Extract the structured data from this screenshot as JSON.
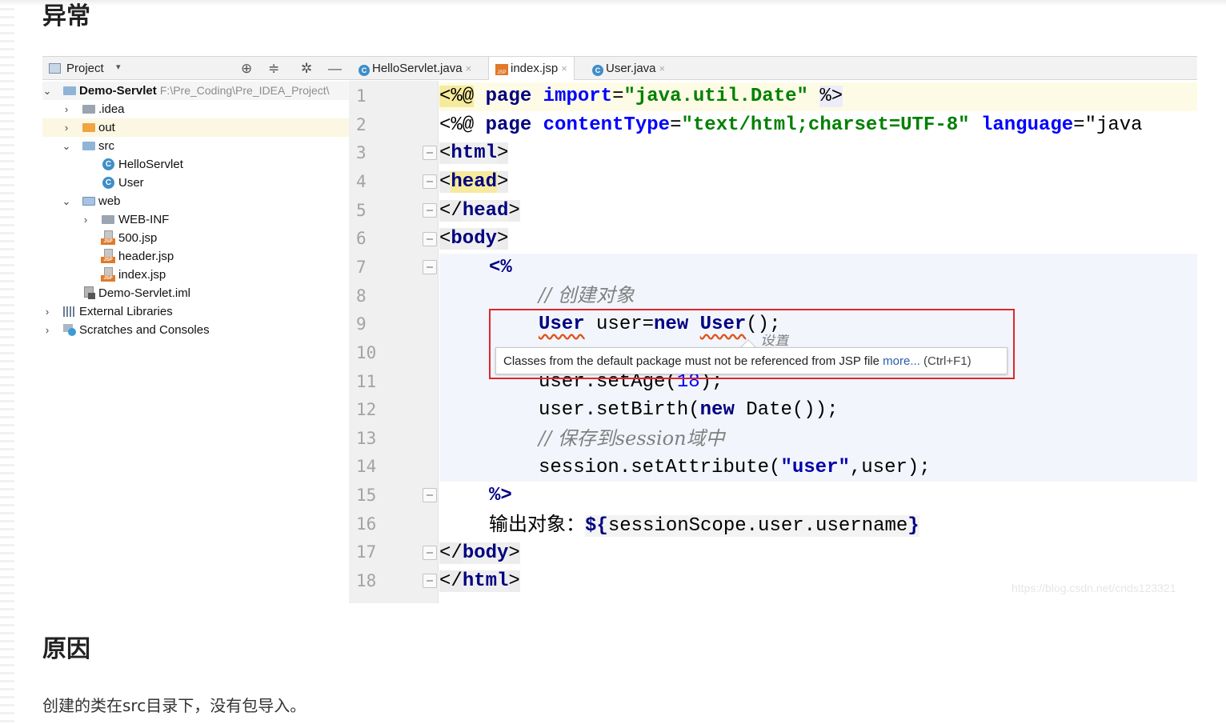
{
  "headings": {
    "exception": "异常",
    "reason": "原因"
  },
  "reason_text": "创建的类在src目录下，没有包导入。",
  "project_panel": {
    "title": "Project",
    "dropdown": "▾",
    "toolbar_icons": [
      "target-icon",
      "collapse-icon",
      "gear-icon",
      "minimize-icon"
    ],
    "toolbar_glyphs": [
      "⊕",
      "≑",
      "✲",
      "—"
    ],
    "tree": [
      {
        "label": "Demo-Servlet",
        "path": "F:\\Pre_Coding\\Pre_IDEA_Project\\",
        "icon": "module-folder-icon",
        "arrow": "⌄"
      },
      {
        "label": ".idea",
        "icon": "folder-icon",
        "arrow": "›"
      },
      {
        "label": "out",
        "icon": "orange-folder-icon",
        "arrow": "›"
      },
      {
        "label": "src",
        "icon": "source-folder-icon",
        "arrow": "⌄"
      },
      {
        "label": "HelloServlet",
        "icon": "class-icon"
      },
      {
        "label": "User",
        "icon": "class-icon"
      },
      {
        "label": "web",
        "icon": "web-folder-icon",
        "arrow": "⌄"
      },
      {
        "label": "WEB-INF",
        "icon": "folder-icon",
        "arrow": "›"
      },
      {
        "label": "500.jsp",
        "icon": "jsp-file-icon"
      },
      {
        "label": "header.jsp",
        "icon": "jsp-file-icon"
      },
      {
        "label": "index.jsp",
        "icon": "jsp-file-icon"
      },
      {
        "label": "Demo-Servlet.iml",
        "icon": "iml-file-icon"
      },
      {
        "label": "External Libraries",
        "icon": "library-icon",
        "arrow": "›"
      },
      {
        "label": "Scratches and Consoles",
        "icon": "scratches-icon",
        "arrow": "›"
      }
    ]
  },
  "tabs": [
    {
      "label": "HelloServlet.java",
      "close": "×",
      "active": false
    },
    {
      "label": "index.jsp",
      "close": "×",
      "active": true
    },
    {
      "label": "User.java",
      "close": "×",
      "active": false
    }
  ],
  "line_numbers": [
    "1",
    "2",
    "3",
    "4",
    "5",
    "6",
    "7",
    "8",
    "9",
    "10",
    "11",
    "12",
    "13",
    "14",
    "15",
    "16",
    "17",
    "18"
  ],
  "code": {
    "l1": {
      "open": "<%@",
      "page": "page",
      "attr": "import",
      "eq": "=",
      "val": "\"java.util.Date\"",
      "close": "%>"
    },
    "l2": {
      "open": "<%@",
      "page": "page",
      "attr1": "contentType",
      "eq": "=",
      "val1": "\"text/html;charset=UTF-8\"",
      "attr2": "language",
      "val2": "=\"java"
    },
    "l3": {
      "lt": "<",
      "tag": "html",
      "gt": ">"
    },
    "l4": {
      "lt": "<",
      "tag": "head",
      "gt": ">"
    },
    "l5": {
      "lt": "</",
      "tag": "head",
      "gt": ">"
    },
    "l6": {
      "lt": "<",
      "tag": "body",
      "gt": ">"
    },
    "l7": {
      "text": "<%"
    },
    "l8": {
      "text": "// 创建对象"
    },
    "l9": {
      "cls": "User",
      "mid": " user=",
      "new": "new",
      "cls2": "User",
      "end": "();"
    },
    "l10": {
      "text": "设置"
    },
    "l11": {
      "pre": "user.setAge(",
      "num": "18",
      "end": ");"
    },
    "l12": {
      "pre": "user.setBirth(",
      "new": "new",
      "end": " Date());"
    },
    "l13": {
      "text": "// 保存到session域中"
    },
    "l14": {
      "pre": "session.setAttribute(",
      "str": "\"user\"",
      "end": ",user);"
    },
    "l15": {
      "text": "%>"
    },
    "l16": {
      "label": "输出对象：",
      "el_open": "${",
      "expr": "sessionScope.user.username",
      "el_close": "}"
    },
    "l17": {
      "lt": "</",
      "tag": "body",
      "gt": ">"
    },
    "l18": {
      "lt": "</",
      "tag": "html",
      "gt": ">"
    }
  },
  "tooltip": {
    "message": "Classes from the default package must not be referenced from JSP file ",
    "link": "more...",
    "shortcut": " (Ctrl+F1)"
  },
  "watermark": "https://blog.csdn.net/cnds123321",
  "colors": {
    "highlight_box": "#e0262b",
    "keyword": "#000080",
    "attribute": "#0000ff",
    "string": "#008000",
    "comment": "#808080",
    "error_underline": "#e0541b"
  }
}
